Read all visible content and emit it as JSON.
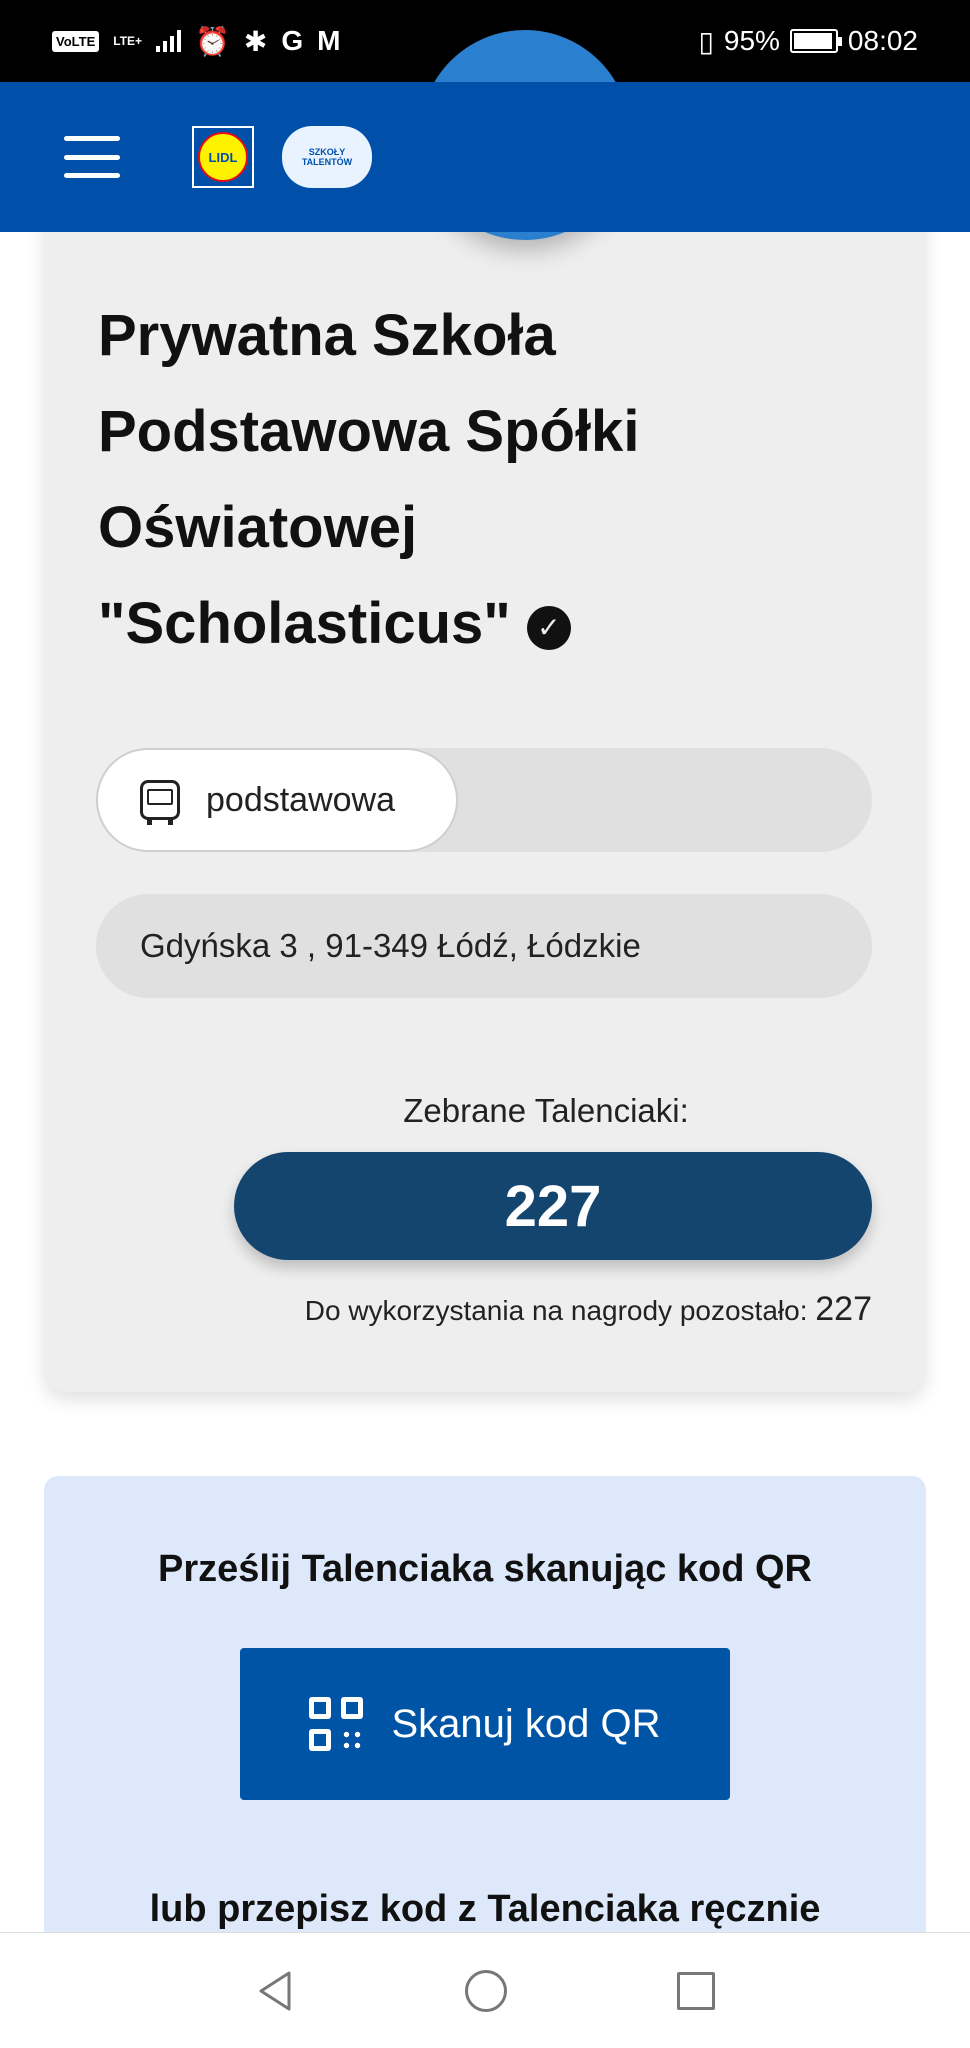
{
  "status_bar": {
    "volte": "VoLTE",
    "network": "LTE+",
    "google_glyph": "G",
    "mail_glyph": "M",
    "battery": "95%",
    "time": "08:02"
  },
  "header": {
    "logo_text": "LIDL",
    "campaign_logo_line1": "SZKOŁY",
    "campaign_logo_line2": "TALENTÓW"
  },
  "school": {
    "name": "Prywatna Szkoła Podstawowa Spółki Oświatowej \"Scholasticus\"",
    "verified_glyph": "✓",
    "type": "podstawowa",
    "address": "Gdyńska 3 , 91-349 Łódź, Łódzkie",
    "collected_label": "Zebrane Talenciaki:",
    "collected_value": "227",
    "remaining_label": "Do wykorzystania na nagrody pozostało:",
    "remaining_value": "227"
  },
  "qr": {
    "heading": "Prześlij Talenciaka skanując kod QR",
    "button_label": "Skanuj kod QR",
    "manual_text": "lub przepisz kod z Talenciaka ręcznie"
  },
  "colors": {
    "brand_blue": "#0050aa",
    "points_navy": "#14456f",
    "qr_card_bg": "#dde9fb"
  }
}
